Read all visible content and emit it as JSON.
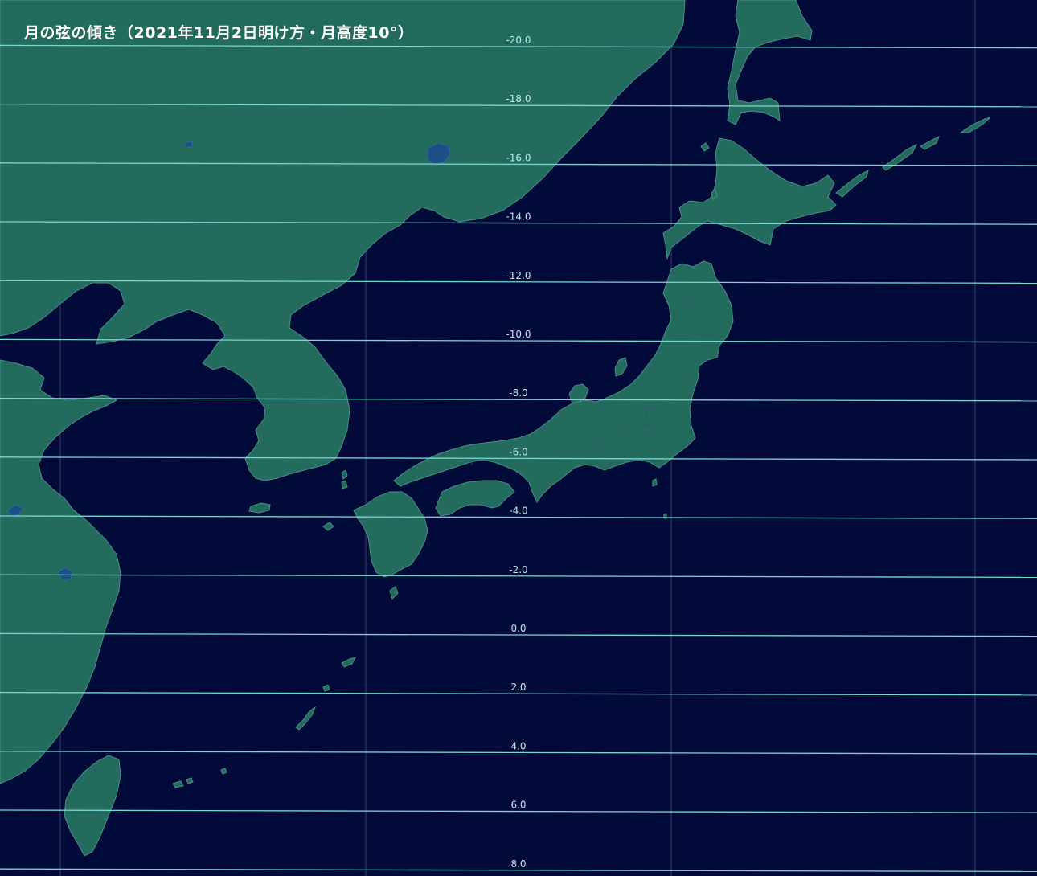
{
  "title": "月の弦の傾き（2021年11月2日明け方・月高度10°）",
  "colors": {
    "ocean": "#020a3a",
    "land": "#236b5d",
    "coastline": "#4a8f86",
    "lake": "#1c4f86",
    "contour_line": "#7ad6d0",
    "contour_label": "#bfe8ee",
    "grid_line": "#ffffff"
  },
  "contours": [
    {
      "value": -20.0,
      "label": "-20.0"
    },
    {
      "value": -18.0,
      "label": "-18.0"
    },
    {
      "value": -16.0,
      "label": "-16.0"
    },
    {
      "value": -14.0,
      "label": "-14.0"
    },
    {
      "value": -12.0,
      "label": "-12.0"
    },
    {
      "value": -10.0,
      "label": "-10.0"
    },
    {
      "value": -8.0,
      "label": "-8.0"
    },
    {
      "value": -6.0,
      "label": "-6.0"
    },
    {
      "value": -4.0,
      "label": "-4.0"
    },
    {
      "value": -2.0,
      "label": "-2.0"
    },
    {
      "value": 0.0,
      "label": "0.0"
    },
    {
      "value": 2.0,
      "label": "2.0"
    },
    {
      "value": 4.0,
      "label": "4.0"
    },
    {
      "value": 6.0,
      "label": "6.0"
    },
    {
      "value": 8.0,
      "label": "8.0"
    }
  ]
}
